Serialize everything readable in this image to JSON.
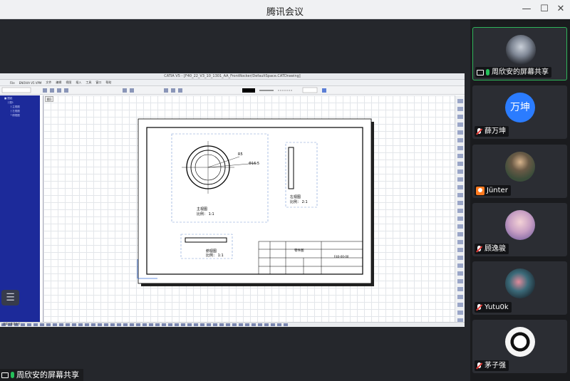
{
  "app": {
    "title": "腾讯会议"
  },
  "window_controls": {
    "minimize": "—",
    "maximize": "☐",
    "close": "✕"
  },
  "shared_screen": {
    "sharer_label": "周欣安的屏幕共享",
    "catia_title": "CATIA V5 - [F40_22_V3_10_1301_AA_FrontRocker/DefaultSpace.CATDrawing]",
    "menus": [
      "File",
      "ENOVIA V5 VPM",
      "文件",
      "编辑",
      "视图",
      "插入",
      "工具",
      "窗口",
      "帮助"
    ],
    "sheet_tab": "图1",
    "drawing": {
      "front_view_label": "主视图",
      "front_scale": "比例：  1:1",
      "side_view_label": "左视图",
      "side_scale": "比例：  2:1",
      "bottom_view_label": "俯视图",
      "bottom_scale": "比例：  1:1",
      "dim_1": "R5",
      "dim_2": "Φ16.5",
      "title_block_name": "零件图",
      "title_block_code": "F40-00-00"
    },
    "status_text": "选择对象或命令"
  },
  "participants": [
    {
      "name": "周欣安的屏幕共享",
      "avatar_type": "photo",
      "mic": "on",
      "screen_share": true,
      "active": true
    },
    {
      "name": "薛万坤",
      "avatar_type": "text",
      "avatar_text": "万坤",
      "avatar_color": "#2b7cff",
      "mic": "muted"
    },
    {
      "name": "Jünter",
      "avatar_type": "photo",
      "mic": "user-icon"
    },
    {
      "name": "顾逸骏",
      "avatar_type": "photo",
      "mic": "muted"
    },
    {
      "name": "Yutu0k",
      "avatar_type": "photo",
      "mic": "muted"
    },
    {
      "name": "茅子强",
      "avatar_type": "photo",
      "mic": "muted"
    }
  ],
  "colors": {
    "accent_green": "#2fb45a",
    "mic_green": "#25c05a",
    "muted_red": "#e53935",
    "catia_tree": "#1c2a9a"
  }
}
